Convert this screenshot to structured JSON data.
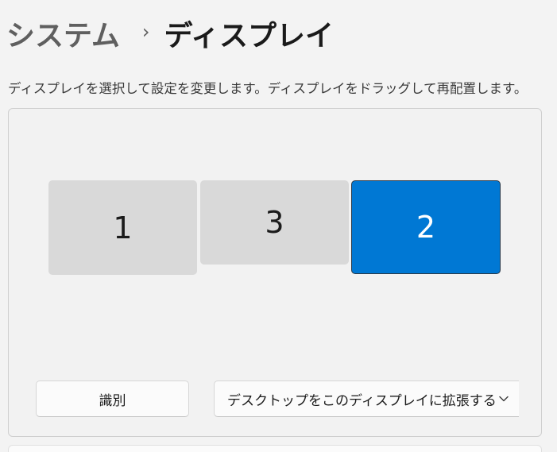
{
  "breadcrumb": {
    "parent": "システム",
    "separator": "›",
    "current": "ディスプレイ"
  },
  "description": "ディスプレイを選択して設定を変更します。ディスプレイをドラッグして再配置します。",
  "displays": [
    {
      "label": "1",
      "selected": false
    },
    {
      "label": "3",
      "selected": false
    },
    {
      "label": "2",
      "selected": true
    }
  ],
  "identify_button": {
    "label": "識別"
  },
  "multi_display_mode": {
    "selected": "デスクトップをこのディスプレイに拡張する",
    "icon": "chevron-down-icon"
  },
  "colors": {
    "accent": "#0078d4",
    "background": "#f3f3f3",
    "monitor_inactive": "#d9d9d9"
  }
}
